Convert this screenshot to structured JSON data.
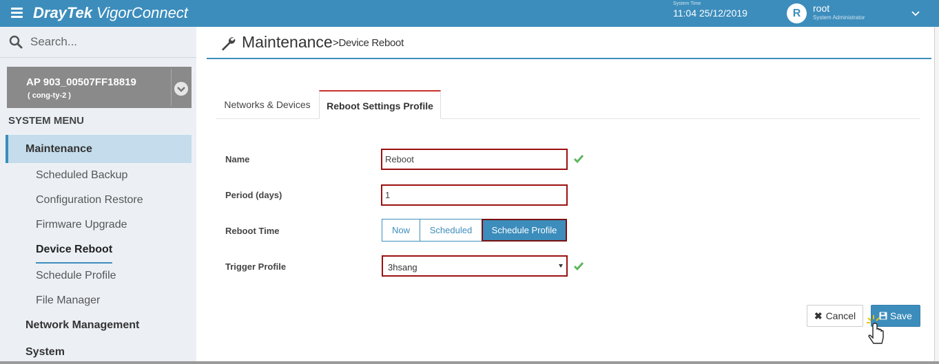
{
  "header": {
    "brand_bold": "DrayTek",
    "brand_app": "VigorConnect",
    "system_time_label": "System Time",
    "system_time": "11:04 25/12/2019",
    "avatar_letter": "R",
    "user_name": "root",
    "user_role": "System Administrator"
  },
  "sidebar": {
    "search_placeholder": "Search...",
    "device_name": "AP 903_00507FF18819",
    "device_sub": "( cong-ty-2 )",
    "section_title": "SYSTEM MENU",
    "active_menu": "Maintenance",
    "sub_items": [
      "Scheduled Backup",
      "Configuration Restore",
      "Firmware Upgrade",
      "Device Reboot",
      "Schedule Profile",
      "File Manager"
    ],
    "current_sub_item": "Device Reboot",
    "menu_items": [
      "Network Management",
      "System"
    ]
  },
  "page": {
    "title": "Maintenance",
    "breadcrumb": ">Device Reboot",
    "tabs": [
      "Networks & Devices",
      "Reboot Settings Profile"
    ],
    "active_tab": "Reboot Settings Profile"
  },
  "form": {
    "name_label": "Name",
    "name_value": "Reboot",
    "period_label": "Period (days)",
    "period_value": "1",
    "reboot_time_label": "Reboot Time",
    "reboot_options": [
      "Now",
      "Scheduled",
      "Schedule Profile"
    ],
    "reboot_selected": "Schedule Profile",
    "trigger_label": "Trigger Profile",
    "trigger_value": "3hsang"
  },
  "actions": {
    "cancel_label": "Cancel",
    "save_label": "Save"
  },
  "colors": {
    "accent": "#3c8dbc",
    "highlight_border": "#9b1010",
    "valid_check": "#5cb85c"
  }
}
